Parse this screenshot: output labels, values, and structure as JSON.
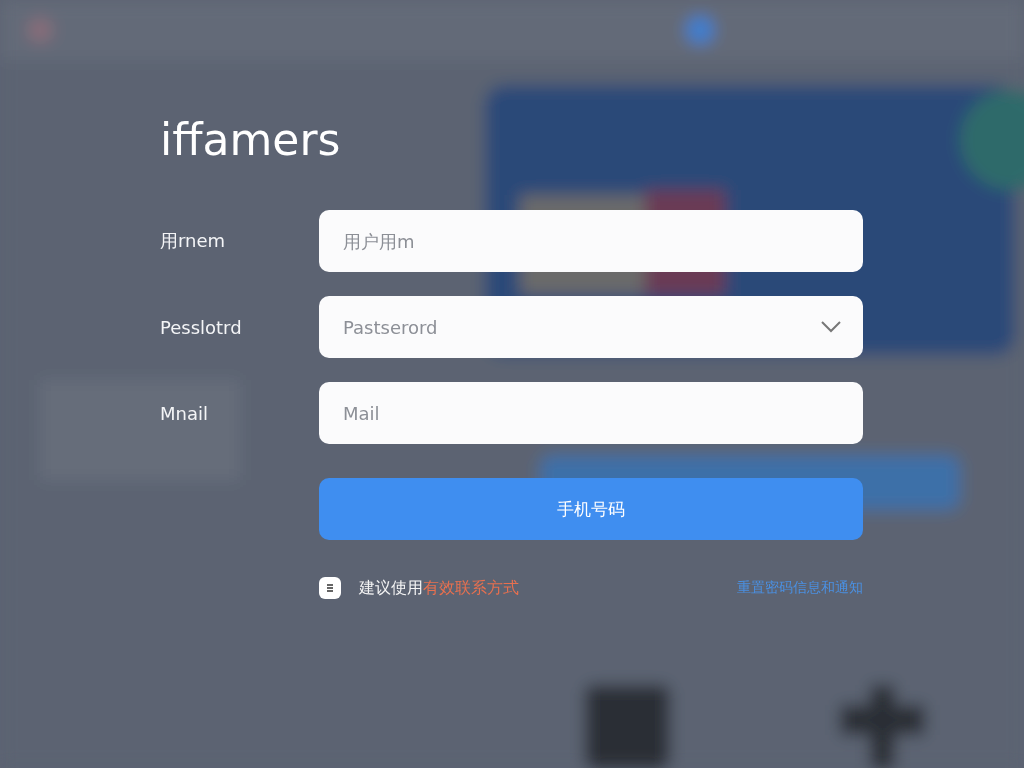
{
  "title": "iffamers",
  "fields": [
    {
      "label": "用rnem",
      "placeholder": "用户用m",
      "kind": "text"
    },
    {
      "label": "Pesslotrd",
      "placeholder": "Pastserord",
      "kind": "select"
    },
    {
      "label": "Mnail",
      "placeholder": "Mail",
      "kind": "text"
    }
  ],
  "submit": "手机号码",
  "consent": {
    "checked": true,
    "text": "建议使用",
    "highlight": "有效联系方式"
  },
  "link": "重置密码信息和通知"
}
